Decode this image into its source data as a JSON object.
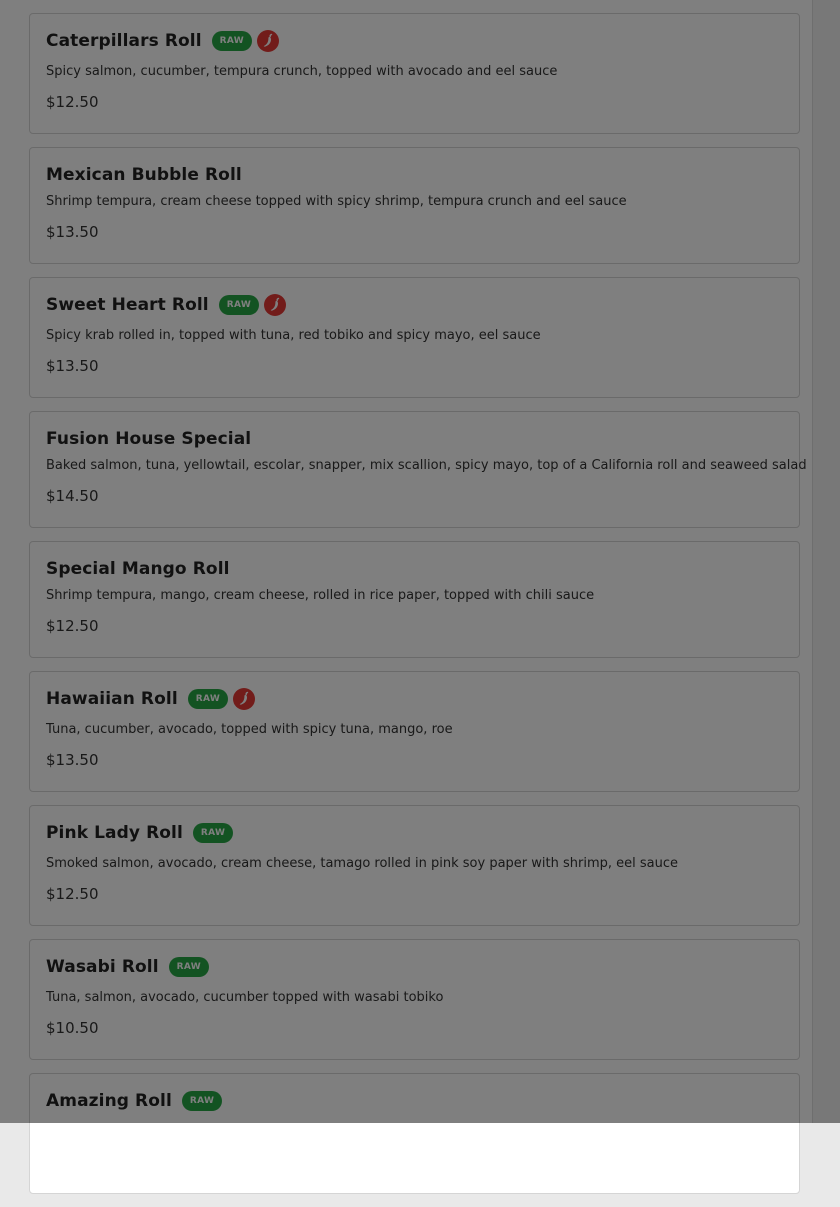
{
  "colors": {
    "raw_badge_bg": "#27a745",
    "spicy_icon": "#e53935",
    "overlay": "rgba(0,0,0,0.5)"
  },
  "items": [
    {
      "name": "",
      "raw_label": "",
      "description": "",
      "price": ""
    },
    {
      "name": "Caterpillars Roll",
      "raw_label": "RAW",
      "spicy_icon": "chili-pepper-icon",
      "description": "Spicy salmon, cucumber, tempura crunch, topped with avocado and eel sauce",
      "price": "$12.50"
    },
    {
      "name": "Mexican Bubble Roll",
      "description": "Shrimp tempura, cream cheese topped with spicy shrimp, tempura crunch and eel sauce",
      "price": "$13.50"
    },
    {
      "name": "Sweet Heart Roll",
      "raw_label": "RAW",
      "spicy_icon": "chili-pepper-icon",
      "description": "Spicy krab rolled in, topped with tuna, red tobiko and spicy mayo, eel sauce",
      "price": "$13.50"
    },
    {
      "name": "Fusion House Special",
      "description": "Baked salmon, tuna, yellowtail, escolar, snapper, mix scallion, spicy mayo, top of a California roll and seaweed salad",
      "price": "$14.50"
    },
    {
      "name": "Special Mango Roll",
      "description": "Shrimp tempura, mango, cream cheese, rolled in rice paper, topped with chili sauce",
      "price": "$12.50"
    },
    {
      "name": "Hawaiian Roll",
      "raw_label": "RAW",
      "spicy_icon": "chili-pepper-icon",
      "description": "Tuna, cucumber, avocado, topped with spicy tuna, mango, roe",
      "price": "$13.50"
    },
    {
      "name": "Pink Lady Roll",
      "raw_label": "RAW",
      "description": "Smoked salmon, avocado, cream cheese, tamago rolled in pink soy paper with shrimp, eel sauce",
      "price": "$12.50"
    },
    {
      "name": "Wasabi Roll",
      "raw_label": "RAW",
      "description": "Tuna, salmon, avocado, cucumber topped with wasabi tobiko",
      "price": "$10.50"
    },
    {
      "name": "Amazing Roll",
      "raw_label": "RAW",
      "description": "",
      "price": ""
    }
  ]
}
